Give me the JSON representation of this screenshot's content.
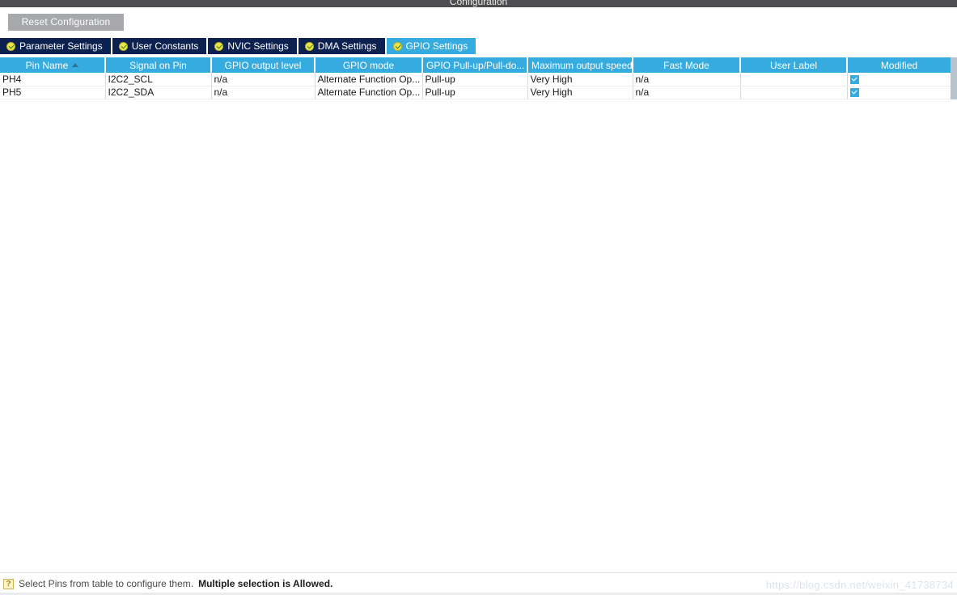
{
  "window": {
    "title": "Configuration"
  },
  "toolbar": {
    "reset_label": "Reset Configuration"
  },
  "tabs": [
    {
      "label": "Parameter Settings",
      "active": false,
      "icon": "check-circle-icon"
    },
    {
      "label": "User Constants",
      "active": false,
      "icon": "check-circle-icon"
    },
    {
      "label": "NVIC Settings",
      "active": false,
      "icon": "check-circle-icon"
    },
    {
      "label": "DMA Settings",
      "active": false,
      "icon": "check-circle-icon"
    },
    {
      "label": "GPIO Settings",
      "active": true,
      "icon": "check-circle-icon"
    }
  ],
  "table": {
    "columns": [
      {
        "label": "Pin Name",
        "sorted": true,
        "sort_dir": "asc"
      },
      {
        "label": "Signal on Pin",
        "sorted": false
      },
      {
        "label": "GPIO output level",
        "sorted": false
      },
      {
        "label": "GPIO mode",
        "sorted": false
      },
      {
        "label": "GPIO Pull-up/Pull-do...",
        "sorted": false
      },
      {
        "label": "Maximum output speed",
        "sorted": false
      },
      {
        "label": "Fast Mode",
        "sorted": false
      },
      {
        "label": "User Label",
        "sorted": false
      },
      {
        "label": "Modified",
        "sorted": false
      }
    ],
    "rows": [
      {
        "pin_name": "PH4",
        "signal_on_pin": "I2C2_SCL",
        "gpio_output_level": "n/a",
        "gpio_mode": "Alternate Function Op...",
        "gpio_pull": "Pull-up",
        "max_output_speed": "Very High",
        "fast_mode": "n/a",
        "user_label": "",
        "modified": true
      },
      {
        "pin_name": "PH5",
        "signal_on_pin": "I2C2_SDA",
        "gpio_output_level": "n/a",
        "gpio_mode": "Alternate Function Op...",
        "gpio_pull": "Pull-up",
        "max_output_speed": "Very High",
        "fast_mode": "n/a",
        "user_label": "",
        "modified": true
      }
    ]
  },
  "statusbar": {
    "icon": "help-question-icon",
    "icon_glyph": "?",
    "text": "Select Pins from table to configure them.",
    "emphasis": "Multiple selection is Allowed."
  },
  "watermark": {
    "text": "https://blog.csdn.net/weixin_41738734"
  },
  "colors": {
    "accent_blue": "#36abe0",
    "tab_navy": "#0d2150",
    "title_bar": "#4e4e50",
    "button_gray": "#a6a8ab",
    "check_yellow": "#e9e54a"
  }
}
